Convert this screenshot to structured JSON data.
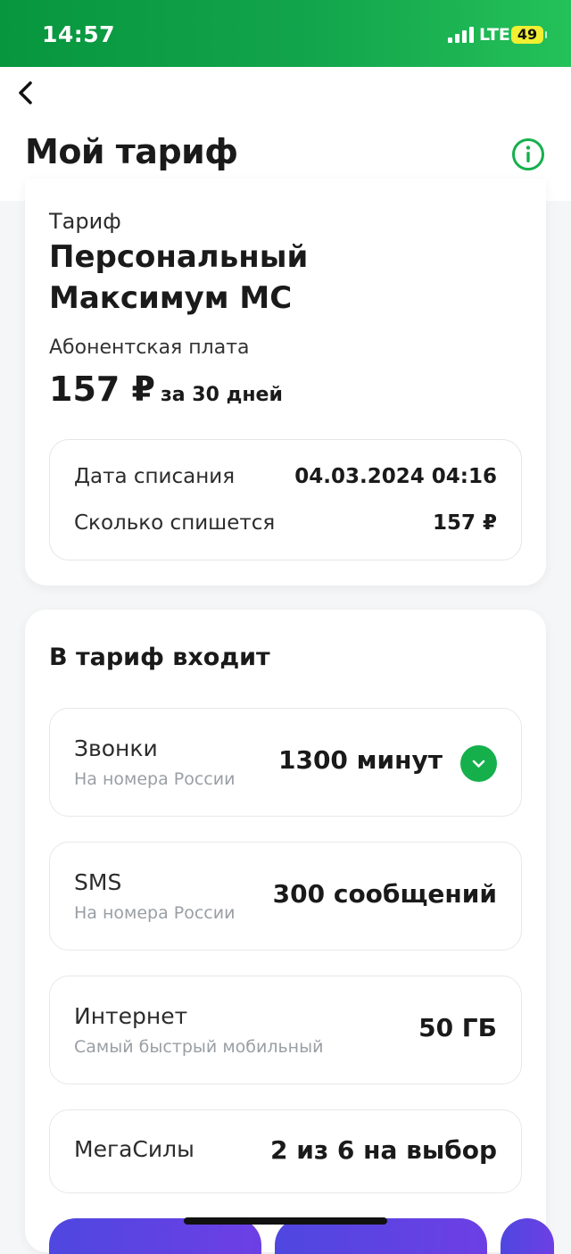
{
  "status_bar": {
    "time": "14:57",
    "network": "LTE",
    "battery": "49"
  },
  "header": {
    "title": "Мой тариф"
  },
  "tariff": {
    "label": "Тариф",
    "name_line1": "Персональный",
    "name_line2": "Максимум МС",
    "fee_label": "Абонентская плата",
    "price": "157 ₽",
    "period": "за 30 дней",
    "charge": {
      "date_label": "Дата списания",
      "date_value": "04.03.2024 04:16",
      "amount_label": "Сколько спишется",
      "amount_value": "157 ₽"
    }
  },
  "includes": {
    "title": "В тариф входит",
    "items": [
      {
        "name": "Звонки",
        "sub": "На номера России",
        "value": "1300 минут"
      },
      {
        "name": "SMS",
        "sub": "На номера России",
        "value": "300 сообщений"
      },
      {
        "name": "Интернет",
        "sub": "Самый быстрый мобильный",
        "value": "50 ГБ"
      },
      {
        "name": "МегаСилы",
        "sub": "",
        "value": "2 из 6 на выбор"
      }
    ]
  },
  "colors": {
    "accent": "#15b04c",
    "status_bar": "#07963e",
    "promo": "#5a45e2"
  }
}
